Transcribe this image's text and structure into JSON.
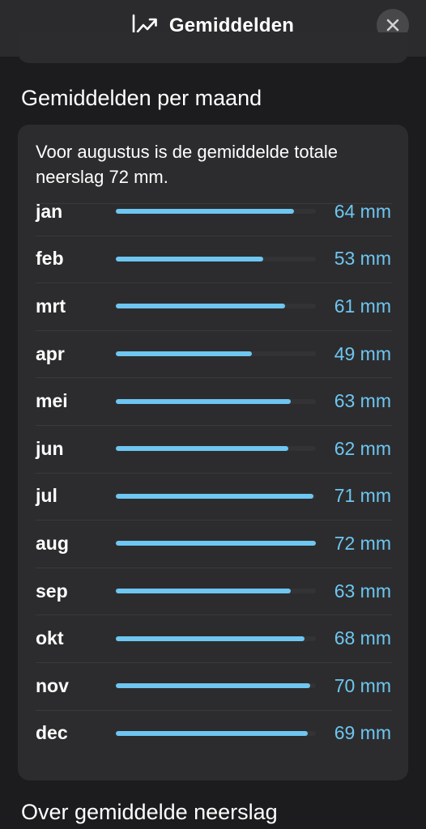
{
  "header": {
    "title": "Gemiddelden",
    "icon": "chart-trend-icon",
    "close_icon": "close-icon"
  },
  "section_averages": {
    "title": "Gemiddelden per maand",
    "summary": "Voor augustus is de gemiddelde totale neerslag 72 mm."
  },
  "colors": {
    "accent": "#6ec6f1",
    "background": "#1c1c1e",
    "card": "#2c2c2e",
    "track": "#333335"
  },
  "chart_data": {
    "type": "bar",
    "orientation": "horizontal",
    "unit": "mm",
    "max": 72,
    "categories": [
      "jan",
      "feb",
      "mrt",
      "apr",
      "mei",
      "jun",
      "jul",
      "aug",
      "sep",
      "okt",
      "nov",
      "dec"
    ],
    "values": [
      64,
      53,
      61,
      49,
      63,
      62,
      71,
      72,
      63,
      68,
      70,
      69
    ],
    "value_labels": [
      "64 mm",
      "53 mm",
      "61 mm",
      "49 mm",
      "63 mm",
      "62 mm",
      "71 mm",
      "72 mm",
      "63 mm",
      "68 mm",
      "70 mm",
      "69 mm"
    ]
  },
  "section_about": {
    "title": "Over gemiddelde neerslag"
  }
}
